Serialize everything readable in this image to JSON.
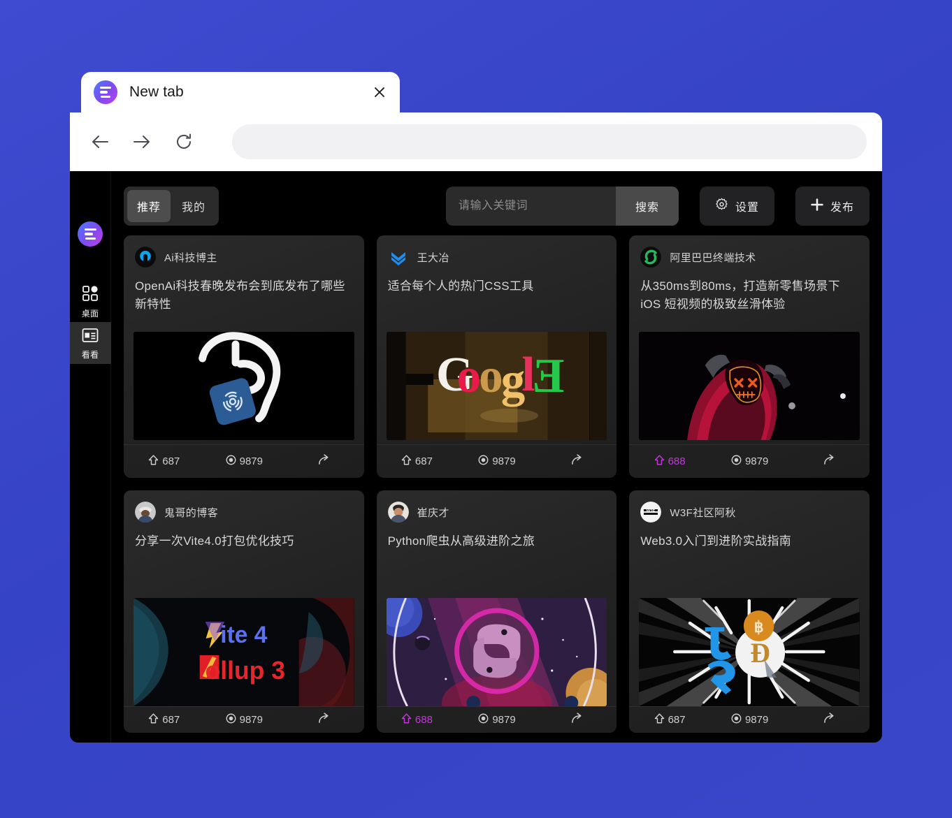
{
  "colors": {
    "page_background": "#3a46c9",
    "app_background": "#000000",
    "card_background": "#242424",
    "accent_like": "#c03ad6",
    "logo_gradient_from": "#4a7dff",
    "logo_gradient_to": "#c63fe6"
  },
  "browser": {
    "tab": {
      "title": "New tab",
      "favicon": "app-logo-icon",
      "close": "close-icon"
    },
    "nav": {
      "back": "back-arrow-icon",
      "forward": "forward-arrow-icon",
      "reload": "reload-icon",
      "url_value": "",
      "url_placeholder": ""
    }
  },
  "sidebar": {
    "logo": "app-logo-icon",
    "items": [
      {
        "label": "桌面",
        "icon": "grid-icon",
        "active": false
      },
      {
        "label": "看看",
        "icon": "layout-panel-icon",
        "active": true
      }
    ]
  },
  "toolbar": {
    "tabs": [
      {
        "label": "推荐",
        "active": true
      },
      {
        "label": "我的",
        "active": false
      }
    ],
    "search": {
      "value": "",
      "placeholder": "请输入关键词",
      "button_label": "搜索"
    },
    "settings_label": "设置",
    "settings_icon": "gear-icon",
    "publish_label": "发布",
    "publish_icon": "plus-icon"
  },
  "cards": [
    {
      "author": "Ai科技博主",
      "avatar": "openai-logo-avatar",
      "title": "OpenAi科技春晚发布会到底发布了哪些新特性",
      "media": "openai-head-illustration",
      "likes": "687",
      "liked": false,
      "views": "9879",
      "share_icon": "share-arrow-icon",
      "like_icon": "upvote-arrow-icon",
      "view_icon": "eye-icon"
    },
    {
      "author": "王大冶",
      "avatar": "double-chevron-avatar",
      "title": "适合每个人的热门CSS工具",
      "media": "google-neon-sign",
      "likes": "687",
      "liked": false,
      "views": "9879",
      "share_icon": "share-arrow-icon",
      "like_icon": "upvote-arrow-icon",
      "view_icon": "eye-icon"
    },
    {
      "author": "阿里巴巴终端技术",
      "avatar": "alibaba-green-avatar",
      "title": "从350ms到80ms，打造新零售场景下 iOS 短视频的极致丝滑体验",
      "media": "hooded-mask-figure",
      "likes": "688",
      "liked": true,
      "views": "9879",
      "share_icon": "share-arrow-icon",
      "like_icon": "upvote-arrow-icon",
      "view_icon": "eye-icon"
    },
    {
      "author": "鬼哥的博客",
      "avatar": "photo-avatar-ghost",
      "title": "分享一次Vite4.0打包优化技巧",
      "media": "vite4-rollup3-banner",
      "media_text": [
        "Vite 4",
        "Rollup 3"
      ],
      "likes": "687",
      "liked": false,
      "views": "9879",
      "share_icon": "share-arrow-icon",
      "like_icon": "upvote-arrow-icon",
      "view_icon": "eye-icon"
    },
    {
      "author": "崔庆才",
      "avatar": "photo-avatar-cui",
      "title": "Python爬虫从高级进阶之旅",
      "media": "python-logo-cosmic",
      "likes": "688",
      "liked": true,
      "views": "9879",
      "share_icon": "share-arrow-icon",
      "like_icon": "upvote-arrow-icon",
      "view_icon": "eye-icon"
    },
    {
      "author": "W3F社区阿秋",
      "avatar": "w3f-white-avatar",
      "title": "Web3.0入门到进阶实战指南",
      "media": "crypto-tunnel-logos",
      "likes": "687",
      "liked": false,
      "views": "9879",
      "share_icon": "share-arrow-icon",
      "like_icon": "upvote-arrow-icon",
      "view_icon": "eye-icon"
    }
  ]
}
